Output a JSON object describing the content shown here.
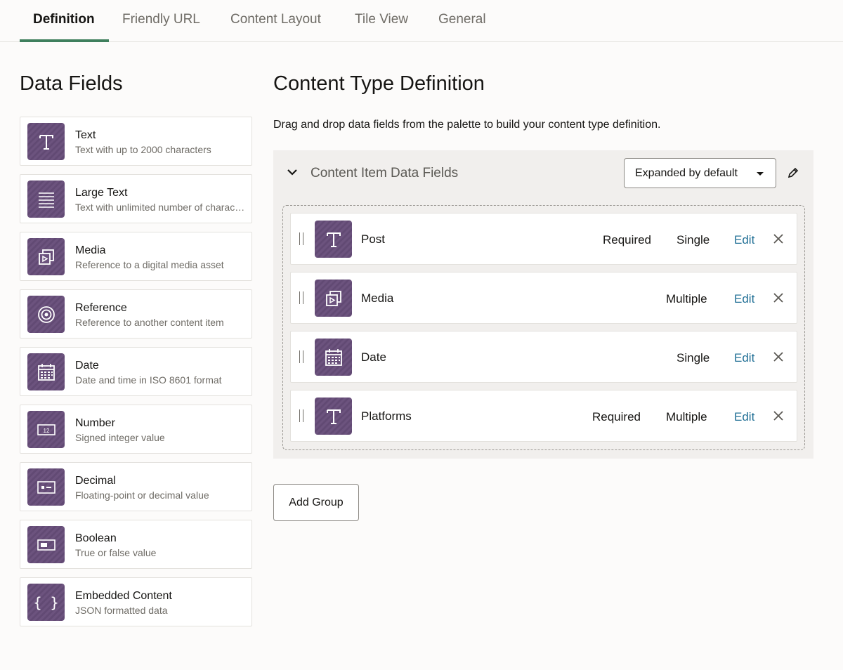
{
  "tabs": [
    {
      "label": "Definition",
      "active": true
    },
    {
      "label": "Friendly URL",
      "active": false
    },
    {
      "label": "Content Layout",
      "active": false
    },
    {
      "label": "Tile View",
      "active": false
    },
    {
      "label": "General",
      "active": false
    }
  ],
  "palette": {
    "heading": "Data Fields",
    "items": [
      {
        "icon": "text-icon",
        "title": "Text",
        "desc": "Text with up to 2000 characters"
      },
      {
        "icon": "large-text-icon",
        "title": "Large Text",
        "desc": "Text with unlimited number of characters"
      },
      {
        "icon": "media-icon",
        "title": "Media",
        "desc": "Reference to a digital media asset"
      },
      {
        "icon": "reference-icon",
        "title": "Reference",
        "desc": "Reference to another content item"
      },
      {
        "icon": "date-icon",
        "title": "Date",
        "desc": "Date and time in ISO 8601 format"
      },
      {
        "icon": "number-icon",
        "title": "Number",
        "desc": "Signed integer value",
        "glyph": "12"
      },
      {
        "icon": "decimal-icon",
        "title": "Decimal",
        "desc": "Floating-point or decimal value"
      },
      {
        "icon": "boolean-icon",
        "title": "Boolean",
        "desc": "True or false value"
      },
      {
        "icon": "embedded-content-icon",
        "title": "Embedded Content",
        "desc": "JSON formatted data",
        "glyph": "{ }"
      }
    ]
  },
  "definition": {
    "heading": "Content Type Definition",
    "instructions": "Drag and drop data fields from the palette to build your content type definition.",
    "group": {
      "title": "Content Item Data Fields",
      "display_mode": "Expanded by default",
      "fields": [
        {
          "icon": "text-icon",
          "name": "Post",
          "required": "Required",
          "cardinality": "Single",
          "edit": "Edit"
        },
        {
          "icon": "media-icon",
          "name": "Media",
          "required": "",
          "cardinality": "Multiple",
          "edit": "Edit"
        },
        {
          "icon": "date-icon",
          "name": "Date",
          "required": "",
          "cardinality": "Single",
          "edit": "Edit"
        },
        {
          "icon": "text-icon",
          "name": "Platforms",
          "required": "Required",
          "cardinality": "Multiple",
          "edit": "Edit"
        }
      ]
    },
    "add_group_label": "Add Group"
  },
  "colors": {
    "accent_underline": "#3f7f5d",
    "icon_tile": "#6c537e",
    "link": "#227096",
    "background": "#fcfbfa",
    "group_background": "#f1efed"
  }
}
